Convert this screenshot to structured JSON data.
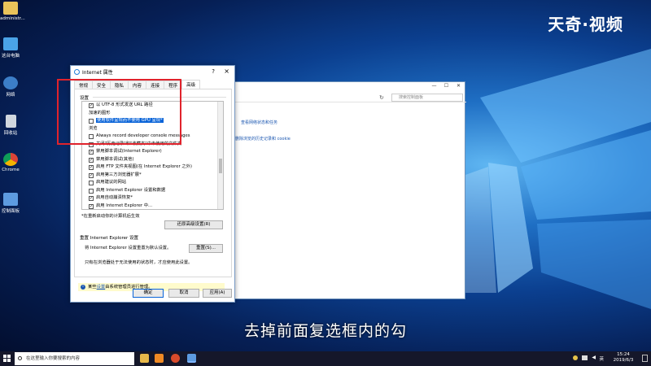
{
  "logo": {
    "text": "天奇·视频"
  },
  "desktop": {
    "icons": [
      {
        "label": "administr...",
        "icon": "user-folder-icon"
      },
      {
        "label": "这台电脑",
        "icon": "computer-icon"
      },
      {
        "label": "网络",
        "icon": "network-icon"
      },
      {
        "label": "回收站",
        "icon": "recycle-bin-icon"
      },
      {
        "label": "Chrome",
        "icon": "chrome-icon"
      },
      {
        "label": "控制面板",
        "icon": "control-panel-icon"
      }
    ]
  },
  "control_panel": {
    "search_placeholder": "搜索控制面板",
    "link1": "查看网络状态和任务",
    "link2": "删除浏览的历史记录和 cookie"
  },
  "dialog": {
    "title": "Internet 属性",
    "help": "?",
    "close": "×",
    "tabs": [
      "常规",
      "安全",
      "隐私",
      "内容",
      "连接",
      "程序",
      "高级"
    ],
    "settings_label": "设置",
    "list": [
      {
        "type": "check",
        "checked": true,
        "text": "以 UTF-8 形式发送 URL 路径"
      },
      {
        "type": "group",
        "text": "加速的图形"
      },
      {
        "type": "check",
        "checked": false,
        "selected": true,
        "text": "使用软件呈现而不使用 GPU 呈现*"
      },
      {
        "type": "group",
        "text": "浏览"
      },
      {
        "type": "check",
        "checked": false,
        "text": "Always record developer console messages"
      },
      {
        "type": "check",
        "checked": false,
        "text": "关闭\"历史记录\"和\"收藏夹\"中未使用的文件夹"
      },
      {
        "type": "check",
        "checked": true,
        "text": "禁用脚本调试(Internet Explorer)"
      },
      {
        "type": "check",
        "checked": true,
        "text": "禁用脚本调试(其他)"
      },
      {
        "type": "check",
        "checked": true,
        "text": "启用 FTP 文件夹视图(在 Internet Explorer 之外)"
      },
      {
        "type": "check",
        "checked": true,
        "text": "启用第三方浏览器扩展*"
      },
      {
        "type": "check",
        "checked": false,
        "text": "启用建议的网站"
      },
      {
        "type": "check",
        "checked": false,
        "text": "启用 Internet Explorer 设置和数据"
      },
      {
        "type": "check",
        "checked": true,
        "text": "启用自动崩溃恢复*"
      },
      {
        "type": "check",
        "checked": true,
        "text": "启用 Internet Explorer 中..."
      }
    ],
    "restart_note": "*在重新启动你的计算机后生效",
    "restore_btn": "还原高级设置(R)",
    "reset_label": "重置 Internet Explorer 设置",
    "reset_desc": "将 Internet Explorer 设置重置为默认设置。",
    "reset_btn": "重置(S)...",
    "reset_note": "只有在浏览器处于无法使用的状态时，才应使用此设置。",
    "info_prefix": "某些",
    "info_link": "设置",
    "info_suffix": "由系统管理员进行管理。",
    "ok_btn": "确定",
    "cancel_btn": "取消",
    "apply_btn": "应用(A)"
  },
  "subtitle": "去掉前面复选框内的勾",
  "taskbar": {
    "search_placeholder": "在这里输入你要搜索的内容",
    "time": "15:24",
    "date": "2019/6/3",
    "tray_label": "英"
  }
}
